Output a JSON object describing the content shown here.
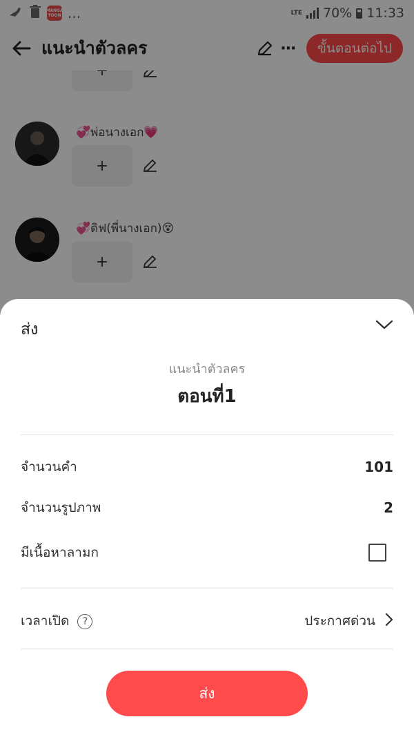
{
  "status_bar": {
    "left_icons": [
      "broom-icon",
      "trash-icon",
      "app-badge-icon"
    ],
    "app_badge_text": "MANGA TOON",
    "ellipsis": "...",
    "network": "LTE",
    "battery": "70%",
    "time": "11:33"
  },
  "top_bar": {
    "title": "แนะนำตัวลคร",
    "next_button": "ขั้นตอนต่อไป"
  },
  "characters": [
    {
      "name": "💞พ่อนางเอก💗",
      "add": "+"
    },
    {
      "name": "💞ดิฟ(พี่นางเอก)😵",
      "add": "+"
    }
  ],
  "partial_add": "+",
  "sheet": {
    "header": "ส่ง",
    "subtitle": "แนะนำตัวลคร",
    "episode": "ตอนที่1",
    "word_count_label": "จำนวนคำ",
    "word_count_value": "101",
    "image_count_label": "จำนวนรูปภาพ",
    "image_count_value": "2",
    "adult_label": "มีเนื้อหาลามก",
    "adult_checked": false,
    "schedule_label": "เวลาเปิด",
    "help_symbol": "?",
    "schedule_value": "ประกาศด่วน",
    "submit_label": "ส่ง"
  },
  "colors": {
    "accent": "#ff4b4b",
    "overlay": "rgba(0,0,0,0.45)"
  }
}
